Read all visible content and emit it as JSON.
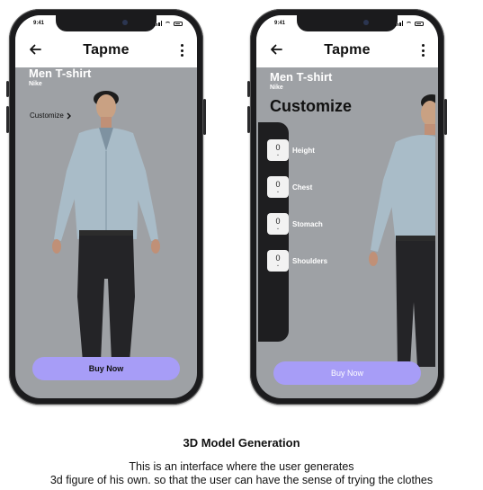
{
  "screen1": {
    "status_time": "9:41",
    "app_title": "Tapme",
    "product_title": "Men T-shirt",
    "product_brand": "Nike",
    "customize_link": "Customize",
    "buy_button": "Buy Now"
  },
  "screen2": {
    "status_time": "9:41",
    "app_title": "Tapme",
    "product_title": "Men T-shirt",
    "product_brand": "Nike",
    "customize_heading": "Customize",
    "measurements": [
      {
        "value": "0",
        "label": "Height"
      },
      {
        "value": "0",
        "label": "Chest"
      },
      {
        "value": "0",
        "label": "Stomach"
      },
      {
        "value": "0",
        "label": "Shoulders"
      }
    ],
    "buy_button": "Buy Now"
  },
  "caption": {
    "title": "3D Model Generation",
    "line1": "This is an interface where the user generates",
    "line2": "3d figure of his own. so that the user can have the sense of trying the clothes"
  },
  "colors": {
    "buy_button": "#a79df7",
    "screen_background": "#9ea1a5",
    "phone_frame": "#1b1b1d"
  },
  "icons": [
    "back-arrow-icon",
    "more-vert-icon",
    "chevron-right-icon",
    "chevron-down-icon",
    "signal-icon",
    "wifi-icon",
    "battery-icon"
  ]
}
